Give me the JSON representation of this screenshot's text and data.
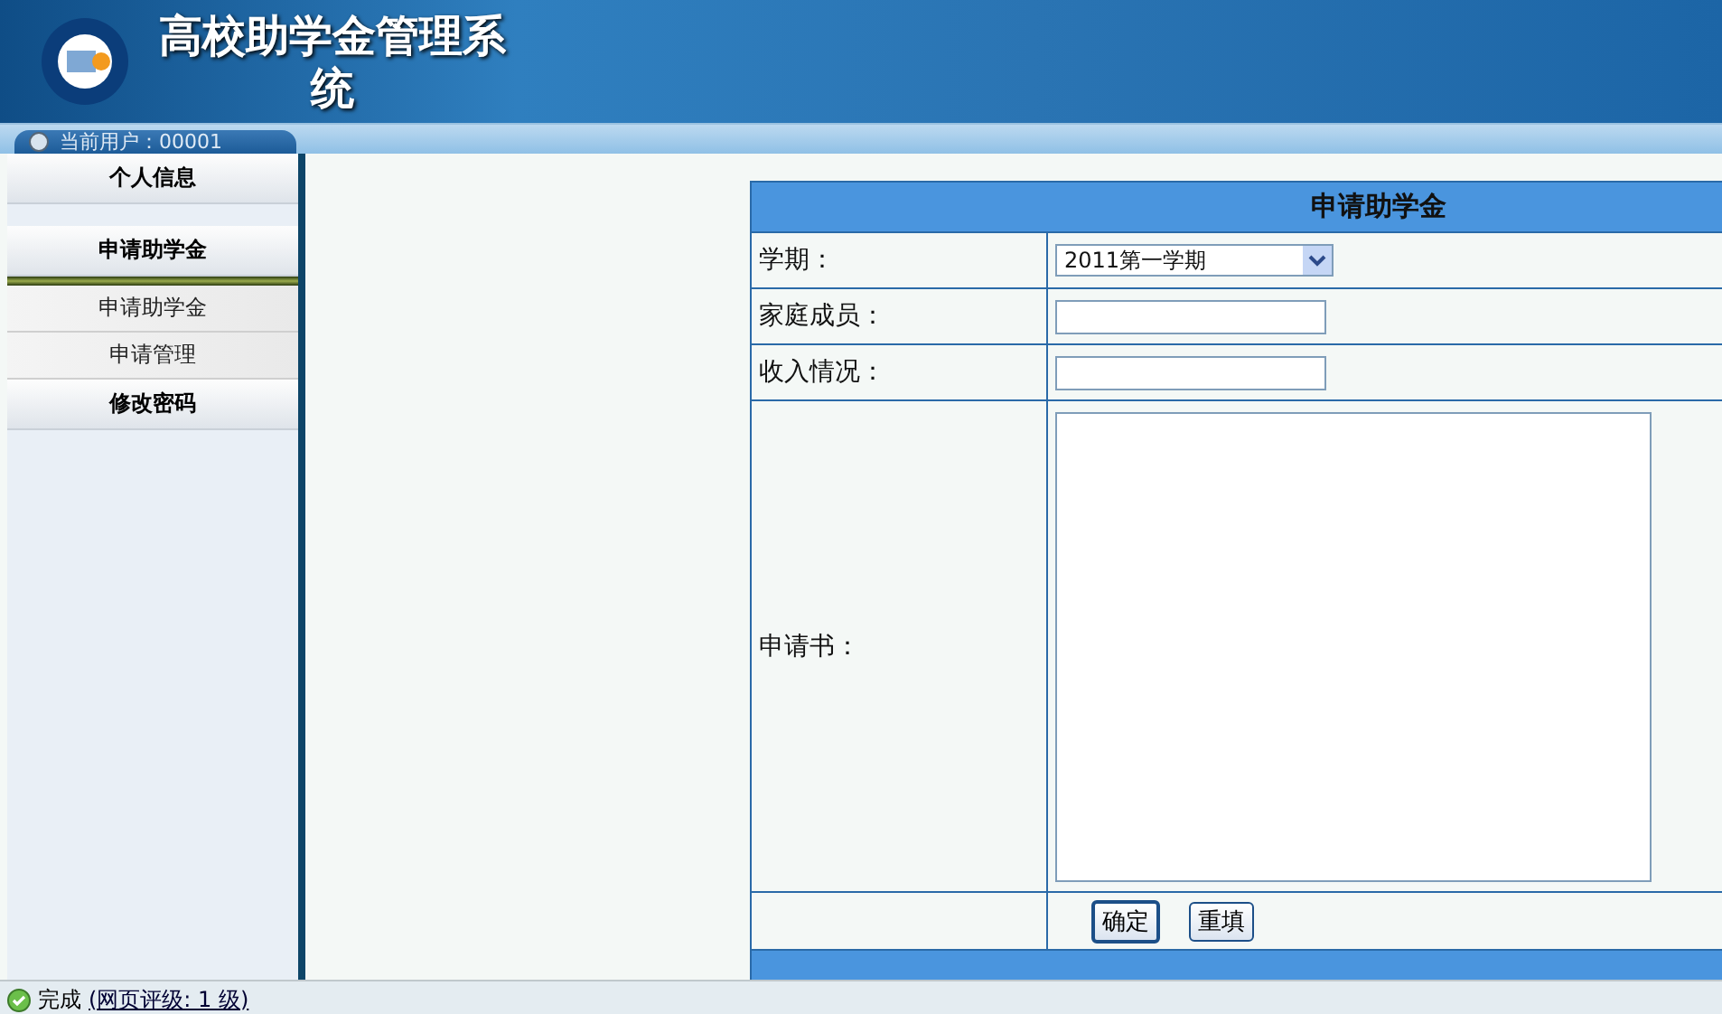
{
  "header": {
    "title": "高校助学金管理系统",
    "user_tab": "当前用户：00001"
  },
  "sidebar": {
    "items": [
      {
        "label": "个人信息"
      },
      {
        "label": "申请助学金",
        "expanded": true,
        "children": [
          {
            "label": "申请助学金"
          },
          {
            "label": "申请管理"
          }
        ]
      },
      {
        "label": "修改密码"
      }
    ]
  },
  "form": {
    "title": "申请助学金",
    "fields": [
      {
        "label": "学期：",
        "kind": "select",
        "value": "2011第一学期"
      },
      {
        "label": "家庭成员：",
        "kind": "input"
      },
      {
        "label": "收入情况：",
        "kind": "input"
      },
      {
        "label": "申请书：",
        "kind": "textarea"
      }
    ],
    "buttons": [
      "确定",
      "重填"
    ]
  },
  "status_bar": {
    "status": "完成",
    "rating": "(网页评级: 1 级)"
  }
}
